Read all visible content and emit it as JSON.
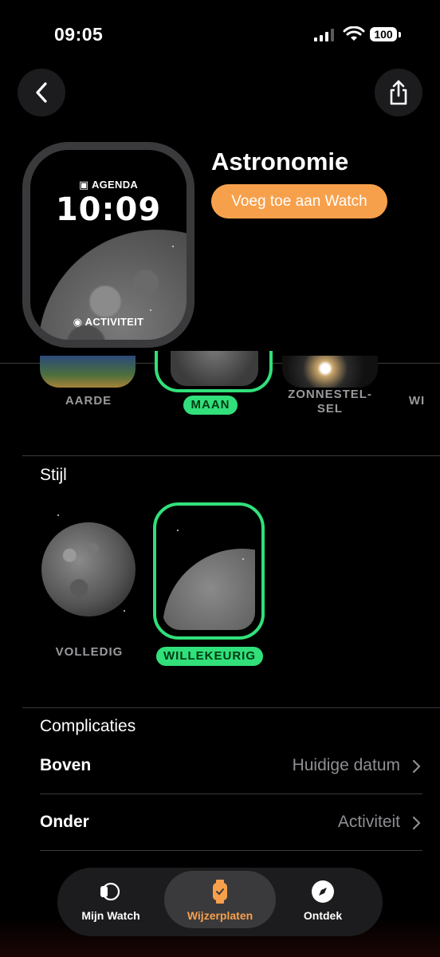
{
  "status": {
    "time": "09:05",
    "battery": "100"
  },
  "header": {
    "title": "Astronomie",
    "add_label": "Voeg toe aan Watch"
  },
  "watch_face": {
    "top_complication": "AGENDA",
    "time": "10:09",
    "bottom_complication": "ACTIVITEIT"
  },
  "faces": [
    {
      "label": "AARDE",
      "selected": false
    },
    {
      "label": "MAAN",
      "selected": true
    },
    {
      "label": "ZONNESTEL-SEL",
      "line1": "ZONNESTEL-",
      "line2": "SEL",
      "selected": false
    },
    {
      "label": "WI",
      "selected": false
    }
  ],
  "style": {
    "title": "Stijl",
    "options": [
      {
        "label": "VOLLEDIG",
        "selected": false
      },
      {
        "label": "WILLEKEURIG",
        "selected": true
      }
    ]
  },
  "complications": {
    "title": "Complicaties",
    "rows": [
      {
        "label": "Boven",
        "value": "Huidige datum"
      },
      {
        "label": "Onder",
        "value": "Activiteit"
      }
    ]
  },
  "tabbar": {
    "tabs": [
      {
        "label": "Mijn Watch",
        "icon": "watch-icon"
      },
      {
        "label": "Wijzerplaten",
        "icon": "watch-face-icon",
        "active": true
      },
      {
        "label": "Ontdek",
        "icon": "compass-icon"
      }
    ]
  },
  "colors": {
    "accent": "#f7a04b",
    "selected": "#31e07a",
    "background": "#000000"
  }
}
